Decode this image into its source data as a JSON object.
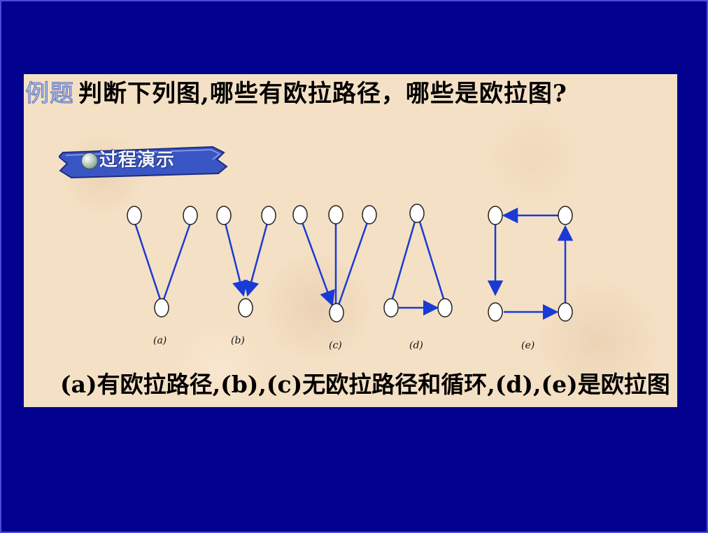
{
  "slide": {
    "tag": "例题",
    "question": "判断下列图,哪些有欧拉路径，哪些是欧拉图?",
    "demo_button_label": "过程演示",
    "answer_text": "(a)有欧拉路径,(b),(c)无欧拉路径和循环,(d),(e)是欧拉图"
  },
  "graphs": [
    {
      "id": "a",
      "label": "(a)",
      "vertices": 3,
      "directed": false
    },
    {
      "id": "b",
      "label": "(b)",
      "vertices": 3,
      "directed": true
    },
    {
      "id": "c",
      "label": "(c)",
      "vertices": 4,
      "directed": true
    },
    {
      "id": "d",
      "label": "(d)",
      "vertices": 3,
      "directed": true
    },
    {
      "id": "e",
      "label": "(e)",
      "vertices": 4,
      "directed": true
    }
  ],
  "colors": {
    "background": "#02028f",
    "panel": "#f4e0c4",
    "edge": "#1a3ad6",
    "badge": "#3a56c4"
  }
}
